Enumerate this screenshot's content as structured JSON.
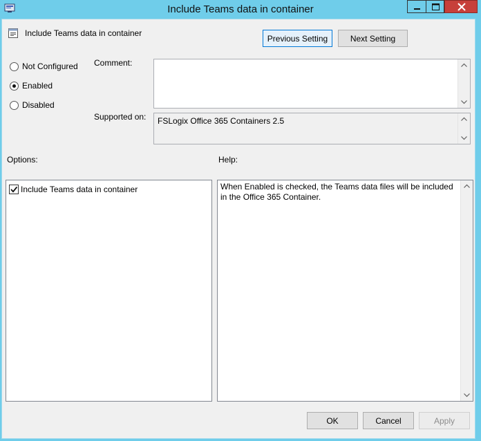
{
  "window": {
    "title": "Include Teams data in container"
  },
  "header": {
    "policy_name": "Include Teams data in container",
    "previous_label": "Previous Setting",
    "next_label": "Next Setting"
  },
  "state": {
    "options": [
      {
        "label": "Not Configured",
        "selected": false
      },
      {
        "label": "Enabled",
        "selected": true
      },
      {
        "label": "Disabled",
        "selected": false
      }
    ]
  },
  "comment": {
    "label": "Comment:",
    "value": ""
  },
  "supported": {
    "label": "Supported on:",
    "value": "FSLogix Office 365 Containers 2.5"
  },
  "options_panel": {
    "label": "Options:",
    "checkbox_label": "Include Teams data in container",
    "checked": true
  },
  "help_panel": {
    "label": "Help:",
    "text": "When Enabled is checked, the Teams data files will be included in the Office 365 Container."
  },
  "footer": {
    "ok_label": "OK",
    "cancel_label": "Cancel",
    "apply_label": "Apply"
  },
  "colors": {
    "titlebar": "#6fcdea",
    "close_button": "#c7403a",
    "dialog_bg": "#f0f0f0"
  }
}
